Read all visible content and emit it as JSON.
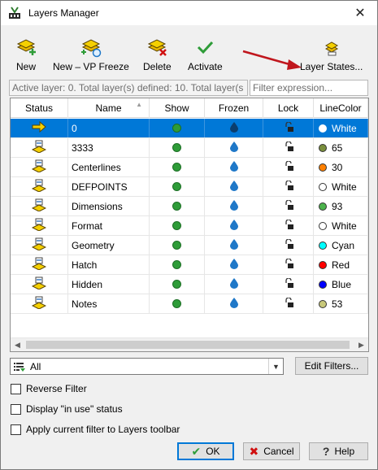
{
  "window": {
    "title": "Layers Manager",
    "close_glyph": "✕"
  },
  "toolbar": {
    "new_label": "New",
    "new_vp_freeze_label": "New – VP Freeze",
    "delete_label": "Delete",
    "activate_label": "Activate",
    "layer_states_label": "Layer States..."
  },
  "info": {
    "status_text": "Active layer: 0. Total layer(s) defined: 10. Total layer(s",
    "filter_placeholder": "Filter expression..."
  },
  "table": {
    "columns": [
      "Status",
      "Name",
      "Show",
      "Frozen",
      "Lock",
      "LineColor"
    ],
    "rows": [
      {
        "name": "0",
        "color_name": "White",
        "swatch": "#ffffff",
        "active": true,
        "selected": true
      },
      {
        "name": "3333",
        "color_name": "65",
        "swatch": "#7a8e3c"
      },
      {
        "name": "Centerlines",
        "color_name": "30",
        "swatch": "#ff8000"
      },
      {
        "name": "DEFPOINTS",
        "color_name": "White",
        "swatch": "#ffffff"
      },
      {
        "name": "Dimensions",
        "color_name": "93",
        "swatch": "#4cb34c"
      },
      {
        "name": "Format",
        "color_name": "White",
        "swatch": "#ffffff"
      },
      {
        "name": "Geometry",
        "color_name": "Cyan",
        "swatch": "#00ffff"
      },
      {
        "name": "Hatch",
        "color_name": "Red",
        "swatch": "#ff0000"
      },
      {
        "name": "Hidden",
        "color_name": "Blue",
        "swatch": "#0000ff"
      },
      {
        "name": "Notes",
        "color_name": "53",
        "swatch": "#c8c87a"
      }
    ]
  },
  "filter": {
    "selected": "All",
    "edit_filters_label": "Edit Filters..."
  },
  "options": {
    "reverse_filter": "Reverse Filter",
    "display_in_use": "Display \"in use\" status",
    "apply_current_filter": "Apply current filter to Layers toolbar"
  },
  "buttons": {
    "ok": "OK",
    "cancel": "Cancel",
    "help": "Help"
  },
  "colors": {
    "selection": "#0078d7",
    "annotation_arrow": "#c0161d"
  }
}
